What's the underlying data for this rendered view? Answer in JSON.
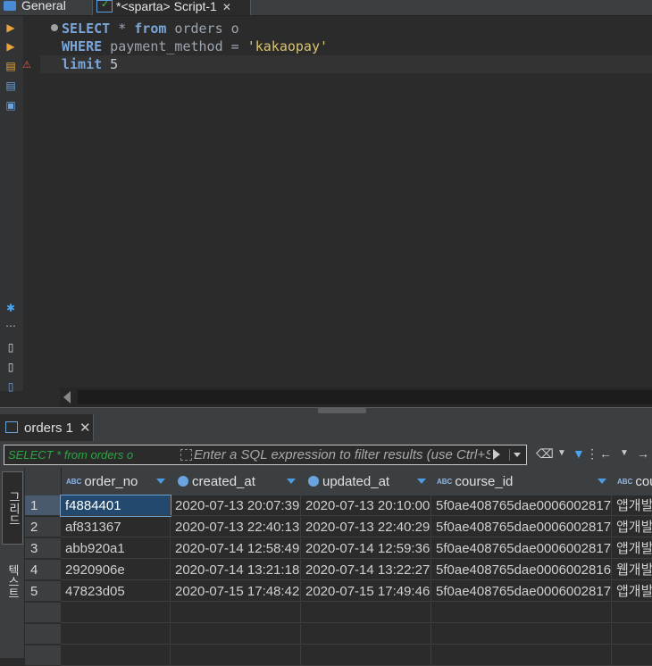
{
  "tabs": [
    {
      "label": "General"
    },
    {
      "label": "*<sparta> Script-1"
    }
  ],
  "editor": {
    "lines": [
      [
        {
          "t": "SELECT",
          "c": "kw"
        },
        {
          "t": " * ",
          "c": "id"
        },
        {
          "t": "from",
          "c": "kw"
        },
        {
          "t": " orders o",
          "c": "id"
        }
      ],
      [
        {
          "t": "WHERE",
          "c": "kw"
        },
        {
          "t": " payment_method = ",
          "c": "id"
        },
        {
          "t": "'kakaopay'",
          "c": "str"
        }
      ],
      [
        {
          "t": "limit",
          "c": "kw"
        },
        {
          "t": " 5",
          "c": "num"
        }
      ]
    ]
  },
  "results": {
    "tab_label": "orders 1",
    "filter_history": "SELECT * from orders o",
    "filter_placeholder": "Enter a SQL expression to filter results (use Ctrl+Space)",
    "side_tabs": [
      "그리드",
      "텍스트"
    ],
    "columns": [
      {
        "name": "order_no",
        "icon": "abc"
      },
      {
        "name": "created_at",
        "icon": "clock"
      },
      {
        "name": "updated_at",
        "icon": "clock"
      },
      {
        "name": "course_id",
        "icon": "abc"
      },
      {
        "name": "course_title",
        "icon": "abc"
      }
    ],
    "rows": [
      {
        "num": "1",
        "cells": [
          "f4884401",
          "2020-07-13 20:07:39",
          "2020-07-13 20:10:00",
          "5f0ae408765dae0006002817",
          "앱개발"
        ]
      },
      {
        "num": "2",
        "cells": [
          "af831367",
          "2020-07-13 22:40:13",
          "2020-07-13 22:40:29",
          "5f0ae408765dae0006002817",
          "앱개발"
        ]
      },
      {
        "num": "3",
        "cells": [
          "abb920a1",
          "2020-07-14 12:58:49",
          "2020-07-14 12:59:36",
          "5f0ae408765dae0006002817",
          "앱개발"
        ]
      },
      {
        "num": "4",
        "cells": [
          "2920906e",
          "2020-07-14 13:21:18",
          "2020-07-14 13:22:27",
          "5f0ae408765dae0006002816",
          "웹개발"
        ]
      },
      {
        "num": "5",
        "cells": [
          "47823d05",
          "2020-07-15 17:48:42",
          "2020-07-15 17:49:46",
          "5f0ae408765dae0006002817",
          "앱개발"
        ]
      }
    ]
  }
}
